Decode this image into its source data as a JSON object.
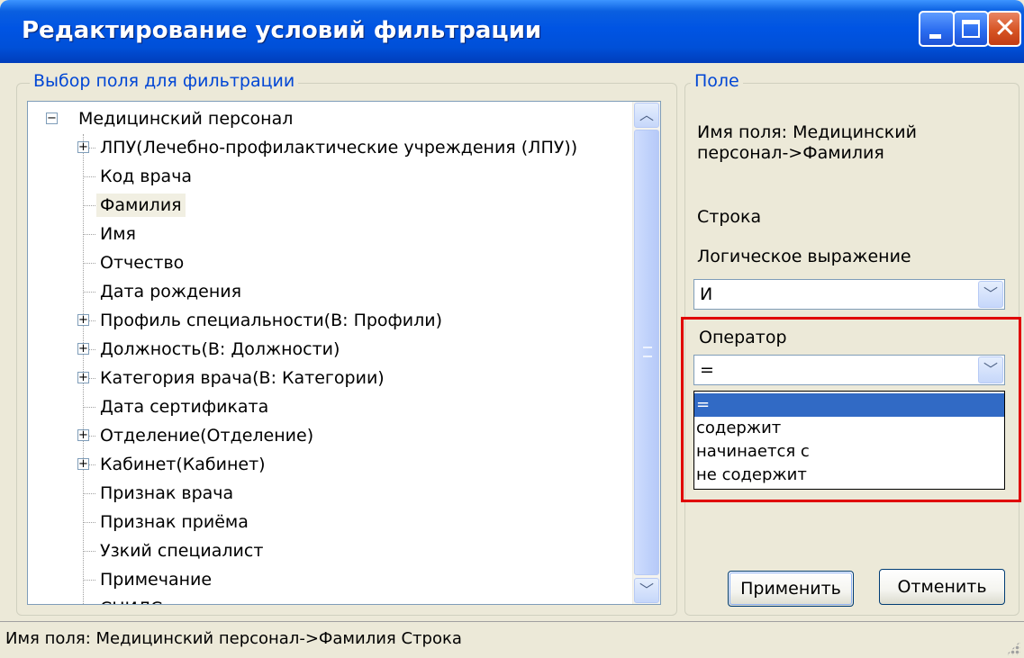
{
  "window": {
    "title": "Редактирование условий фильтрации"
  },
  "left_group": {
    "legend": "Выбор поля для фильтрации",
    "tree": {
      "root": "Медицинский персонал",
      "items": [
        {
          "label": "ЛПУ(Лечебно-профилактические учреждения (ЛПУ))",
          "expandable": true
        },
        {
          "label": "Код врача",
          "expandable": false
        },
        {
          "label": "Фамилия",
          "expandable": false,
          "selected": true
        },
        {
          "label": "Имя",
          "expandable": false
        },
        {
          "label": "Отчество",
          "expandable": false
        },
        {
          "label": "Дата рождения",
          "expandable": false
        },
        {
          "label": "Профиль специальности(В: Профили)",
          "expandable": true
        },
        {
          "label": "Должность(В: Должности)",
          "expandable": true
        },
        {
          "label": "Категория врача(В: Категории)",
          "expandable": true
        },
        {
          "label": "Дата сертификата",
          "expandable": false
        },
        {
          "label": "Отделение(Отделение)",
          "expandable": true
        },
        {
          "label": "Кабинет(Кабинет)",
          "expandable": true
        },
        {
          "label": "Признак врача",
          "expandable": false
        },
        {
          "label": "Признак приёма",
          "expandable": false
        },
        {
          "label": "Узкий специалист",
          "expandable": false
        },
        {
          "label": "Примечание",
          "expandable": false
        },
        {
          "label": "СНИЛС",
          "expandable": false
        }
      ]
    }
  },
  "right_group": {
    "legend": "Поле",
    "field_name": "Имя поля: Медицинский персонал->Фамилия",
    "field_name_line1": "Имя поля: Медицинский",
    "field_name_line2": "персонал->Фамилия",
    "field_type": "Строка",
    "logic_label": "Логическое выражение",
    "logic_value": "И",
    "operator_label": "Оператор",
    "operator_value": "=",
    "operator_options": [
      "=",
      "содержит",
      "начинается с",
      "не содержит"
    ],
    "selected_option": "="
  },
  "buttons": {
    "apply": "Применить",
    "cancel": "Отменить"
  },
  "status_bar": {
    "text": "Имя поля: Медицинский персонал->Фамилия  Строка"
  },
  "colors": {
    "title_bar": "#0054e3",
    "highlight": "#e00000",
    "selection": "#316ac5",
    "group_legend": "#0046d5"
  },
  "icons": [
    "minimize-icon",
    "maximize-icon",
    "close-icon",
    "chevron-up-icon",
    "chevron-down-icon",
    "tree-expand-icon",
    "tree-collapse-icon"
  ]
}
